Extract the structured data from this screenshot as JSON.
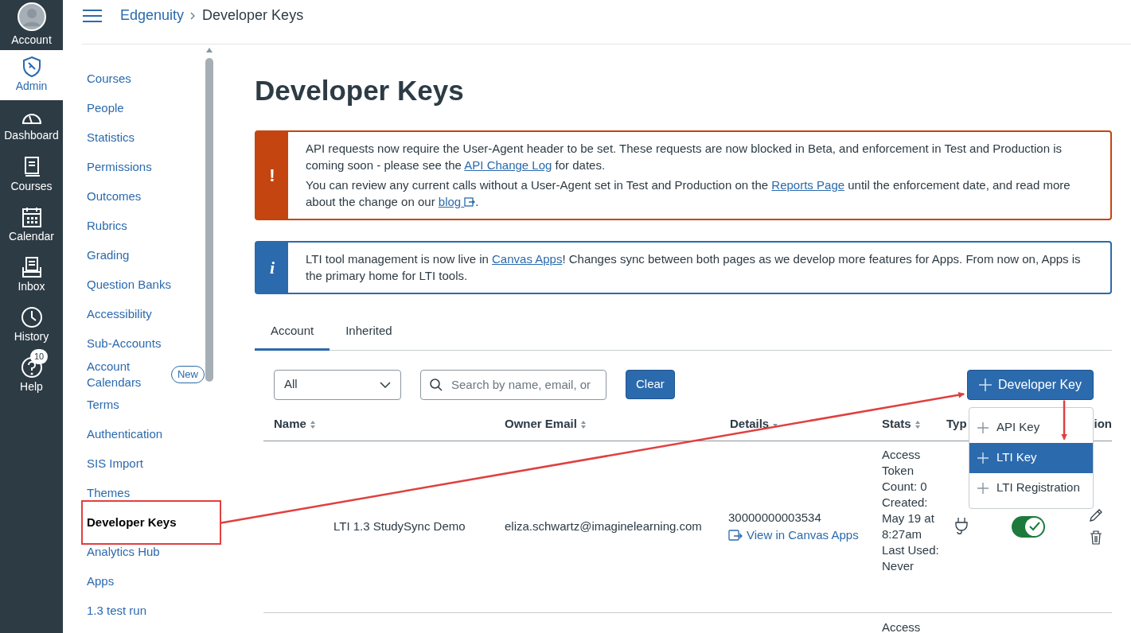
{
  "global_nav": [
    {
      "label": "Account",
      "selected": false
    },
    {
      "label": "Admin",
      "selected": true
    },
    {
      "label": "Dashboard",
      "selected": false
    },
    {
      "label": "Courses",
      "selected": false
    },
    {
      "label": "Calendar",
      "selected": false
    },
    {
      "label": "Inbox",
      "selected": false
    },
    {
      "label": "History",
      "selected": false
    },
    {
      "label": "Help",
      "selected": false,
      "badge": "10"
    }
  ],
  "breadcrumb": [
    "Edgenuity",
    "Developer Keys"
  ],
  "course_nav": [
    {
      "label": "Courses",
      "selected": false
    },
    {
      "label": "People",
      "selected": false
    },
    {
      "label": "Statistics",
      "selected": false
    },
    {
      "label": "Permissions",
      "selected": false
    },
    {
      "label": "Outcomes",
      "selected": false
    },
    {
      "label": "Rubrics",
      "selected": false
    },
    {
      "label": "Grading",
      "selected": false
    },
    {
      "label": "Question Banks",
      "selected": false
    },
    {
      "label": "Accessibility",
      "selected": false
    },
    {
      "label": "Sub-Accounts",
      "selected": false
    },
    {
      "label": "Account Calendars",
      "selected": false,
      "badge": "New"
    },
    {
      "label": "Terms",
      "selected": false
    },
    {
      "label": "Authentication",
      "selected": false
    },
    {
      "label": "SIS Import",
      "selected": false
    },
    {
      "label": "Themes",
      "selected": false
    },
    {
      "label": "Developer Keys",
      "selected": true
    },
    {
      "label": "Analytics Hub",
      "selected": false
    },
    {
      "label": "Apps",
      "selected": false
    },
    {
      "label": "1.3 test run",
      "selected": false
    }
  ],
  "page_title": "Developer Keys",
  "alerts": [
    {
      "kind": "warning",
      "symbol": "!",
      "paragraphs": [
        [
          {
            "text": "API requests now require the User-Agent header to be set. These requests are now blocked in Beta, and enforcement in Test and Production is coming soon - please see the "
          },
          {
            "link": "API Change Log"
          },
          {
            "text": " for dates."
          }
        ],
        [
          {
            "text": "You can review any current calls without a User-Agent set in Test and Production on the "
          },
          {
            "link": "Reports Page"
          },
          {
            "text": " until the enforcement date, and read more about the change on our "
          },
          {
            "link": "blog",
            "external": true
          },
          {
            "text": "."
          }
        ]
      ]
    },
    {
      "kind": "info",
      "symbol": "i",
      "paragraphs": [
        [
          {
            "text": "LTI tool management is now live in "
          },
          {
            "link": "Canvas Apps"
          },
          {
            "text": "! Changes sync between both pages as we develop more features for Apps. From now on, Apps is the primary home for LTI tools."
          }
        ]
      ]
    }
  ],
  "tabs": [
    {
      "label": "Account",
      "selected": true
    },
    {
      "label": "Inherited",
      "selected": false
    }
  ],
  "filter": {
    "value": "All",
    "search_placeholder": "Search by name, email, or",
    "clear": "Clear"
  },
  "add_button": "Developer Key",
  "add_menu": [
    {
      "label": "API Key",
      "selected": false
    },
    {
      "label": "LTI Key",
      "selected": true
    },
    {
      "label": "LTI Registration",
      "selected": false
    }
  ],
  "table": {
    "columns": [
      {
        "label": "Name",
        "sortable": true
      },
      {
        "label": "Owner Email",
        "sortable": true
      },
      {
        "label": "Details",
        "sortable": true,
        "sorted": true
      },
      {
        "label": "Stats",
        "sortable": true
      },
      {
        "label": "Typ"
      },
      {
        "label": "ion"
      }
    ],
    "rows": [
      {
        "name": "LTI 1.3 StudySync Demo",
        "email": "eliza.schwartz@imaginelearning.com",
        "id": "30000000003534",
        "link": "View in Canvas Apps",
        "stats": "Access Token Count: 0 Created: May 19 at 8:27am Last Used: Never",
        "enabled": true
      },
      {
        "stats": "Access"
      }
    ]
  }
}
